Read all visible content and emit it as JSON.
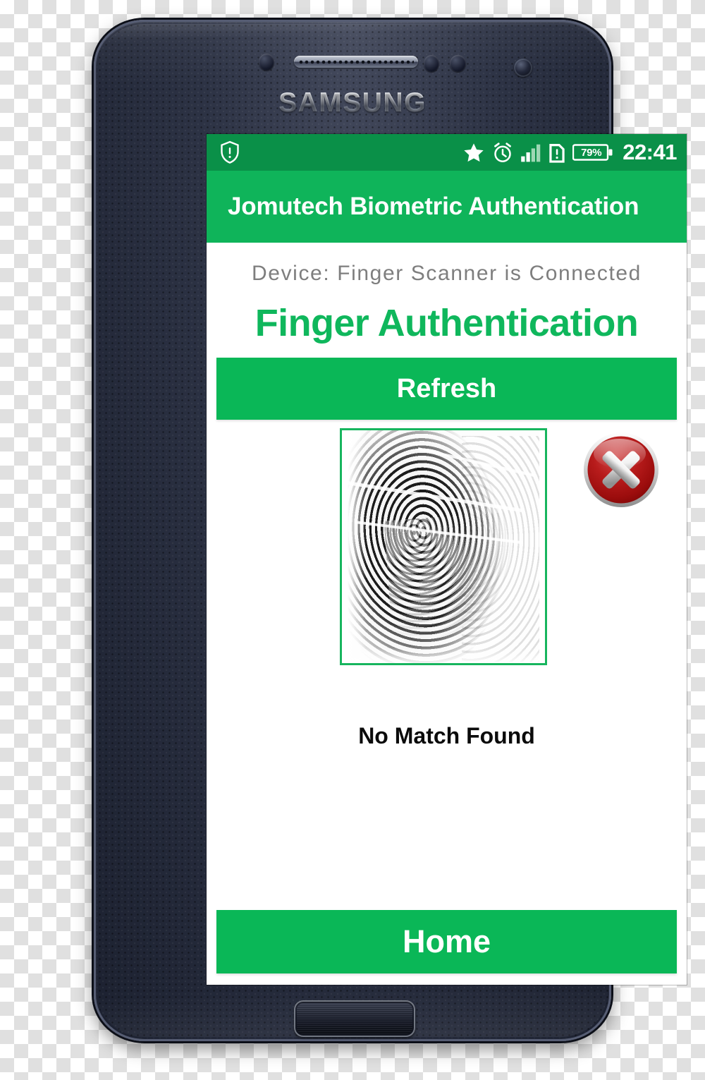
{
  "device": {
    "brand": "SAMSUNG"
  },
  "status_bar": {
    "shield_icon": "shield-alert-icon",
    "star_icon": "star-icon",
    "alarm_icon": "alarm-clock-icon",
    "signal_icon": "signal-bars-icon",
    "sim_icon": "sim-card-alert-icon",
    "battery_icon": "battery-icon",
    "battery_percent": "79%",
    "time": "22:41"
  },
  "app_bar": {
    "title": "Jomutech Biometric Authentication"
  },
  "main": {
    "device_status": "Device:  Finger  Scanner  is  Connected",
    "headline": "Finger Authentication",
    "refresh_label": "Refresh",
    "fingerprint_image_alt": "fingerprint-scan-preview",
    "error_icon": "error-x-circle-icon",
    "result_text": "No Match Found",
    "home_label": "Home"
  },
  "colors": {
    "status_bar_green": "#0a9048",
    "app_bar_green": "#0fb45a",
    "button_green": "#0ab757",
    "headline_green": "#0fb75c",
    "frame_green": "#17b55e",
    "error_red": "#b81c1c",
    "muted_gray": "#7e7e7e"
  }
}
